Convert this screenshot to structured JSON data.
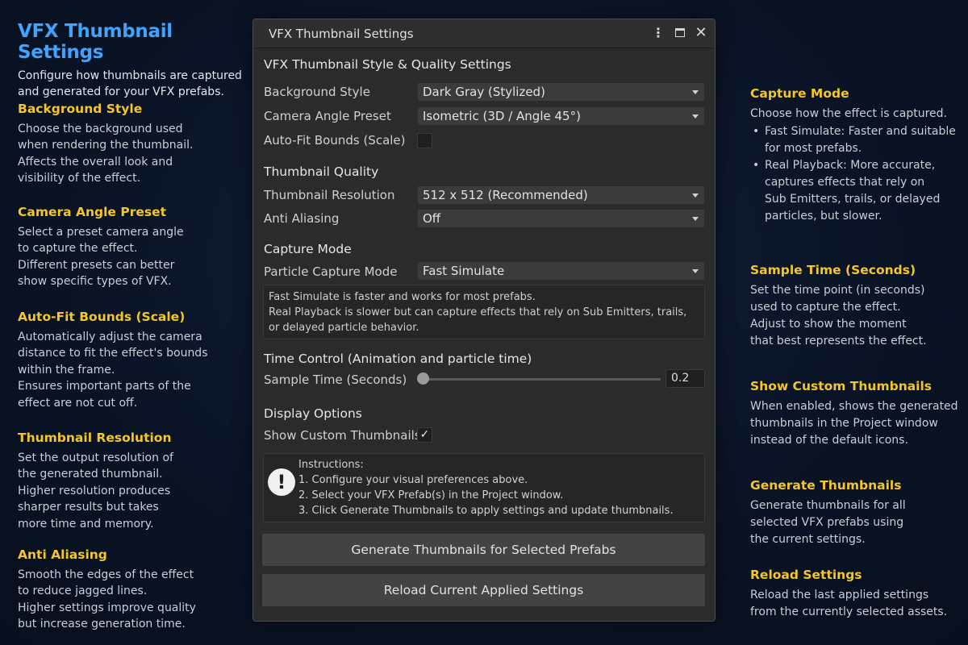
{
  "left": {
    "title": "VFX Thumbnail Settings",
    "subtitle": [
      "Configure how thumbnails are captured",
      "and generated for your VFX prefabs."
    ],
    "sections": [
      {
        "title": "Background Style",
        "lines": [
          "Choose the background used",
          "when rendering the thumbnail.",
          "Affects the overall look and",
          "visibility of the effect."
        ]
      },
      {
        "title": "Camera Angle Preset",
        "lines": [
          "Select a preset camera angle",
          "to capture the effect.",
          "Different presets can better",
          "show specific types of VFX."
        ]
      },
      {
        "title": "Auto-Fit Bounds (Scale)",
        "lines": [
          "Automatically adjust the camera",
          "distance to fit the effect's bounds",
          "within the frame.",
          "Ensures important parts of the",
          "effect are not cut off."
        ]
      },
      {
        "title": "Thumbnail Resolution",
        "lines": [
          "Set the output resolution of",
          "the generated thumbnail.",
          "Higher resolution produces",
          "sharper results but takes",
          "more time and memory."
        ]
      },
      {
        "title": "Anti Aliasing",
        "lines": [
          "Smooth the edges of the effect",
          "to reduce jagged lines.",
          "Higher settings improve quality",
          "but increase generation time."
        ]
      }
    ]
  },
  "right": {
    "capture_mode": {
      "title": "Capture Mode",
      "intro": "Choose how the effect is captured.",
      "bullets": [
        [
          "Fast Simulate: Faster and suitable",
          "for most prefabs."
        ],
        [
          "Real Playback: More accurate,",
          "captures effects that rely on",
          "Sub Emitters, trails, or delayed",
          "particles, but slower."
        ]
      ]
    },
    "sections": [
      {
        "title": "Sample Time (Seconds)",
        "lines": [
          "Set the time point (in seconds)",
          "used to capture the effect.",
          "Adjust to show the moment",
          "that best represents the effect."
        ]
      },
      {
        "title": "Show Custom Thumbnails",
        "lines": [
          "When enabled, shows the generated",
          "thumbnails in the Project window",
          "instead of the default icons."
        ]
      },
      {
        "title": "Generate Thumbnails",
        "lines": [
          "Generate thumbnails for all",
          "selected VFX prefabs using",
          "the current settings."
        ]
      },
      {
        "title": "Reload Settings",
        "lines": [
          "Reload the last applied settings",
          "from the currently selected assets."
        ]
      }
    ]
  },
  "window": {
    "title": "VFX Thumbnail Settings",
    "style_header": "VFX Thumbnail Style & Quality Settings",
    "background_style": {
      "label": "Background Style",
      "value": "Dark Gray (Stylized)"
    },
    "camera_angle": {
      "label": "Camera Angle Preset",
      "value": "Isometric (3D / Angle 45°)"
    },
    "auto_fit": {
      "label": "Auto-Fit Bounds (Scale)",
      "checked": false
    },
    "quality_header": "Thumbnail Quality",
    "resolution": {
      "label": "Thumbnail Resolution",
      "value": "512 x 512 (Recommended)"
    },
    "anti_aliasing": {
      "label": "Anti Aliasing",
      "value": "Off"
    },
    "capture_header": "Capture Mode",
    "capture_mode": {
      "label": "Particle Capture Mode",
      "value": "Fast Simulate"
    },
    "capture_info": [
      "Fast Simulate is faster and works for most prefabs.",
      "Real Playback is slower but can capture effects that rely on Sub Emitters, trails,",
      "or delayed particle behavior."
    ],
    "time_header": "Time Control (Animation and particle time)",
    "sample_time": {
      "label": "Sample Time (Seconds)",
      "value": "0.2"
    },
    "display_header": "Display Options",
    "show_custom": {
      "label": "Show Custom Thumbnails",
      "checked": true,
      "check_glyph": "✓"
    },
    "instructions": {
      "icon": "!",
      "heading": "Instructions:",
      "items": [
        "1.  Configure your visual preferences above.",
        "2.  Select your VFX Prefab(s) in the Project window.",
        "3.  Click Generate Thumbnails to apply settings and update thumbnails."
      ]
    },
    "generate_button": "Generate Thumbnails for Selected Prefabs",
    "reload_button": "Reload Current Applied Settings",
    "icons": {
      "menu": "⋮",
      "maximize": "maximize-icon",
      "close": "✕"
    }
  }
}
